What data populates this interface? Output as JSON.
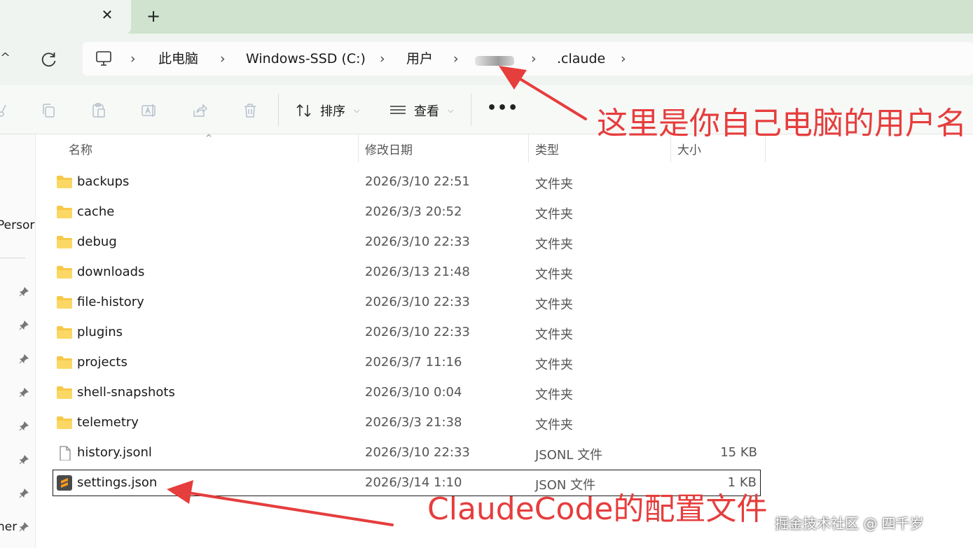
{
  "tabs": {
    "close_glyph": "✕",
    "new_tab_glyph": "+"
  },
  "nav": {
    "up_glyph": "^"
  },
  "breadcrumb": {
    "items": [
      "此电脑",
      "Windows-SSD (C:)",
      "用户",
      ".claude"
    ],
    "separator": "›",
    "blurred_item": "user-name-blurred"
  },
  "toolbar": {
    "sort_label": "排序",
    "view_label": "查看",
    "more_label": "•••"
  },
  "navpane": {
    "partial_label_top": "Persor",
    "partial_label_bottom": "her"
  },
  "columns": {
    "name": "名称",
    "date": "修改日期",
    "type": "类型",
    "size": "大小"
  },
  "files": [
    {
      "name": "backups",
      "date": "2026/3/10 22:51",
      "type": "文件夹",
      "size": "",
      "icon": "folder-icon"
    },
    {
      "name": "cache",
      "date": "2026/3/3 20:52",
      "type": "文件夹",
      "size": "",
      "icon": "folder-icon"
    },
    {
      "name": "debug",
      "date": "2026/3/10 22:33",
      "type": "文件夹",
      "size": "",
      "icon": "folder-icon"
    },
    {
      "name": "downloads",
      "date": "2026/3/13 21:48",
      "type": "文件夹",
      "size": "",
      "icon": "folder-icon"
    },
    {
      "name": "file-history",
      "date": "2026/3/10 22:33",
      "type": "文件夹",
      "size": "",
      "icon": "folder-icon"
    },
    {
      "name": "plugins",
      "date": "2026/3/10 22:33",
      "type": "文件夹",
      "size": "",
      "icon": "folder-icon"
    },
    {
      "name": "projects",
      "date": "2026/3/7 11:16",
      "type": "文件夹",
      "size": "",
      "icon": "folder-icon"
    },
    {
      "name": "shell-snapshots",
      "date": "2026/3/10 0:04",
      "type": "文件夹",
      "size": "",
      "icon": "folder-icon"
    },
    {
      "name": "telemetry",
      "date": "2026/3/3 21:38",
      "type": "文件夹",
      "size": "",
      "icon": "folder-icon"
    },
    {
      "name": "history.jsonl",
      "date": "2026/3/10 22:33",
      "type": "JSONL 文件",
      "size": "15 KB",
      "icon": "document-icon"
    },
    {
      "name": "settings.json",
      "date": "2026/3/14 1:10",
      "type": "JSON 文件",
      "size": "1 KB",
      "icon": "sublime-json-icon"
    }
  ],
  "annotations": {
    "username_note": "这里是你自己电脑的用户名",
    "config_note": "ClaudeCode的配置文件",
    "color": "#e63d3d"
  },
  "watermark": "掘金技术社区 @ 四千岁",
  "colors": {
    "tabstrip": "#cfe3cf",
    "folder": "#f7c948",
    "selection_border": "#1a1a1a"
  }
}
